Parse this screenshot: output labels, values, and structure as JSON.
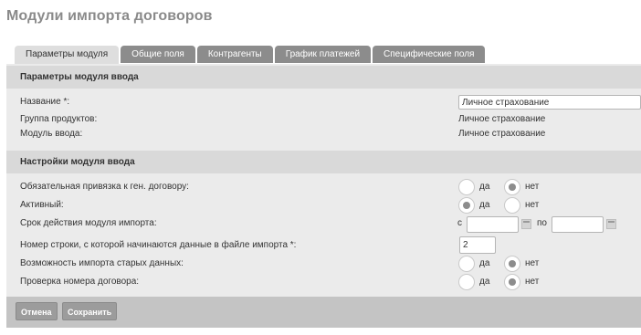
{
  "page_title": "Модули импорта договоров",
  "tabs": [
    {
      "label": "Параметры модуля",
      "active": true
    },
    {
      "label": "Общие поля",
      "active": false
    },
    {
      "label": "Контрагенты",
      "active": false
    },
    {
      "label": "График платежей",
      "active": false
    },
    {
      "label": "Специфические поля",
      "active": false
    }
  ],
  "section_input": {
    "title": "Параметры модуля ввода",
    "name_label": "Название *:",
    "name_value": "Личное страхование",
    "group_label": "Группа продуктов:",
    "group_value": "Личное страхование",
    "module_label": "Модуль ввода:",
    "module_value": "Личное страхование"
  },
  "section_settings": {
    "title": "Настройки модуля ввода",
    "required_link_label": "Обязательная привязка к ген. договору:",
    "required_link_value": "нет",
    "active_label": "Активный:",
    "active_value": "да",
    "validity_label": "Срок действия модуля импорта:",
    "validity_from_label": "с",
    "validity_from_value": "",
    "validity_to_label": "по",
    "validity_to_value": "",
    "start_row_label": "Номер строки, с которой начинаются данные в файле импорта *:",
    "start_row_value": "2",
    "old_data_label": "Возможность импорта старых данных:",
    "old_data_value": "нет",
    "check_number_label": "Проверка номера договора:",
    "check_number_value": "нет",
    "yes_label": "да",
    "no_label": "нет"
  },
  "footer": {
    "cancel_label": "Отмена",
    "save_label": "Сохранить"
  }
}
